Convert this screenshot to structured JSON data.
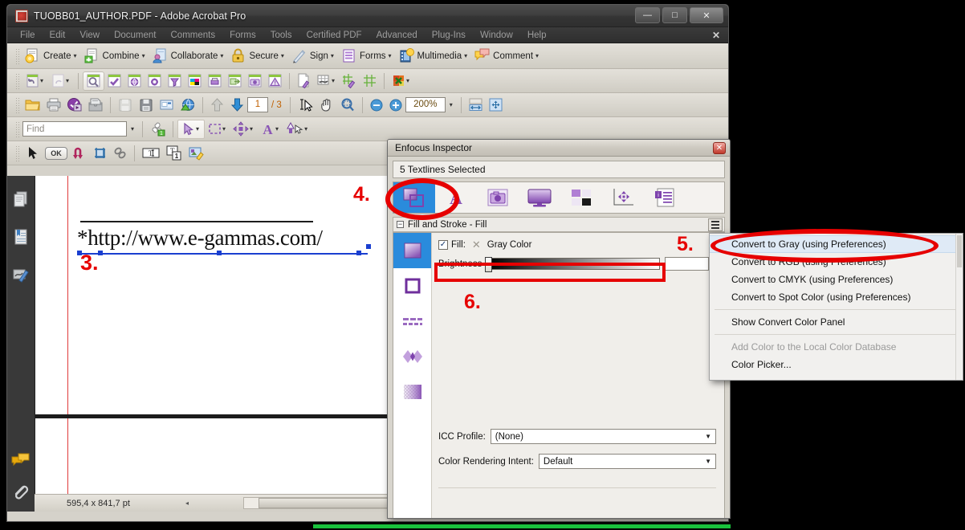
{
  "window": {
    "title": "TUOBB01_AUTHOR.PDF - Adobe Acrobat Pro",
    "app_icon": "pdf-document-icon",
    "minimize_label": "—",
    "maximize_label": "□",
    "close_label": "✕"
  },
  "menubar": {
    "items": [
      "File",
      "Edit",
      "View",
      "Document",
      "Comments",
      "Forms",
      "Tools",
      "Certified PDF",
      "Advanced",
      "Plug-Ins",
      "Window",
      "Help"
    ],
    "close_toolbar_label": "✕"
  },
  "toolbar_main": {
    "buttons": [
      {
        "label": "Create",
        "icon": "create-document-icon",
        "caret": "▾"
      },
      {
        "label": "Combine",
        "icon": "combine-documents-icon",
        "caret": "▾"
      },
      {
        "label": "Collaborate",
        "icon": "collaborate-icon",
        "caret": "▾"
      },
      {
        "label": "Secure",
        "icon": "padlock-icon",
        "caret": "▾"
      },
      {
        "label": "Sign",
        "icon": "pen-sign-icon",
        "caret": "▾"
      },
      {
        "label": "Forms",
        "icon": "forms-icon",
        "caret": "▾"
      },
      {
        "label": "Multimedia",
        "icon": "multimedia-film-icon",
        "caret": "▾"
      },
      {
        "label": "Comment",
        "icon": "comment-bubble-icon",
        "caret": "▾"
      }
    ]
  },
  "toolbar_certified": {
    "icons": [
      "undo-icon",
      "redo-icon",
      "preflight-magnifier-icon",
      "check-icon",
      "globe-icon",
      "gear-icon",
      "funnel-icon",
      "cmyk-swatch-icon",
      "print-icon",
      "export-icon",
      "snapshot-camera-icon",
      "warning-icon",
      "page-edit-icon",
      "table-grid-icon",
      "grid-edit-icon",
      "grid-icon",
      "color-remove-icon"
    ],
    "carets": [
      "▾",
      "▾",
      "▾",
      "▾"
    ]
  },
  "toolbar_file": {
    "icons": [
      "open-folder-icon",
      "print-icon",
      "media-play-icon",
      "archive-icon",
      "save-disabled-icon",
      "save-icon",
      "email-icon",
      "upload-globe-icon"
    ],
    "nav_up": "▲",
    "nav_down": "▼",
    "page_current": "1",
    "page_total": "/ 3",
    "select_tool_icon": "text-select-icon",
    "hand_tool_icon": "hand-icon",
    "marquee_zoom_icon": "marquee-zoom-icon",
    "zoom_out": "−",
    "zoom_in": "+",
    "zoom_value": "200%",
    "zoom_caret": "▾",
    "fit_width_icon": "fit-width-icon",
    "fit_page_icon": "fit-page-icon"
  },
  "toolbar_find": {
    "find_placeholder": "Find",
    "find_value": "",
    "find_caret": "▾",
    "icons": [
      "preflight-fan-icon",
      "object-select-arrow-icon",
      "marquee-select-icon",
      "move-object-icon",
      "text-touchup-icon",
      "pen-touchup-icon"
    ],
    "carets": [
      "▾",
      "▾",
      "▾",
      "▾",
      "▾",
      "▾"
    ]
  },
  "toolbar_pitstop": {
    "icons": [
      "arrow-select-icon",
      "ok-button-icon",
      "curve-arrow-icon",
      "crop-icon",
      "link-chain-icon",
      "text-box-icon",
      "text-page-icon",
      "image-edit-icon"
    ],
    "ok_label": "OK"
  },
  "navpane": {
    "icons": [
      "pages-thumbnail-icon",
      "bookmarks-icon",
      "signatures-icon",
      "comments-icon",
      "attachments-icon"
    ]
  },
  "document": {
    "url_text": "*http://www.e-gammas.com/",
    "page_size": "595,4 x 841,7 pt",
    "scroll_left_arrow": "◂",
    "scroll_grip": "⦀"
  },
  "annotations": {
    "step3": "3.",
    "step4": "4.",
    "step5": "5.",
    "step6": "6.",
    "color": "#e60000"
  },
  "inspector": {
    "title": "Enfocus Inspector",
    "close_label": "✕",
    "selection_label": "5 Textlines Selected",
    "tabs": [
      {
        "name": "fill-stroke-tab",
        "icon": "fill-stroke-shapes-icon",
        "active": true
      },
      {
        "name": "text-tab",
        "icon": "letter-a-icon",
        "active": false
      },
      {
        "name": "image-tab",
        "icon": "camera-image-icon",
        "active": false
      },
      {
        "name": "screen-tab",
        "icon": "monitor-screen-icon",
        "active": false
      },
      {
        "name": "separation-tab",
        "icon": "color-squares-icon",
        "active": false
      },
      {
        "name": "position-tab",
        "icon": "position-move-icon",
        "active": false
      },
      {
        "name": "info-tab",
        "icon": "document-info-icon",
        "active": false
      }
    ],
    "section_title": "Fill and Stroke - Fill",
    "section_expander": "−",
    "hamburger_name": "section-options-menu",
    "swatches": [
      "fill-gradient-swatch",
      "stroke-square-swatch",
      "dashes-swatch",
      "blend-swatch",
      "transparency-swatch"
    ],
    "fill_checkbox_checked": true,
    "fill_checkbox_glyph": "✓",
    "fill_label": "Fill:",
    "fill_x_glyph": "✕",
    "fill_colorspace": "Gray Color",
    "brightness_label": "Brightness",
    "brightness_value": "",
    "icc_profile_label": "ICC Profile:",
    "icc_profile_value": "(None)",
    "rendering_intent_label": "Color Rendering Intent:",
    "rendering_intent_value": "Default",
    "combo_arrow": "▼"
  },
  "context_menu": {
    "items": [
      {
        "label": "Convert to Gray (using Preferences)",
        "state": "highlighted"
      },
      {
        "label": "Convert to RGB (using Preferences)",
        "state": "normal"
      },
      {
        "label": "Convert to CMYK (using Preferences)",
        "state": "normal"
      },
      {
        "label": "Convert to Spot Color (using Preferences)",
        "state": "normal"
      },
      {
        "label": "Show Convert Color Panel",
        "state": "normal"
      },
      {
        "label": "Add Color to the Local Color Database",
        "state": "disabled"
      },
      {
        "label": "Color Picker...",
        "state": "normal"
      }
    ]
  },
  "status": {
    "page_size": "595,4 x 841,7 pt"
  }
}
